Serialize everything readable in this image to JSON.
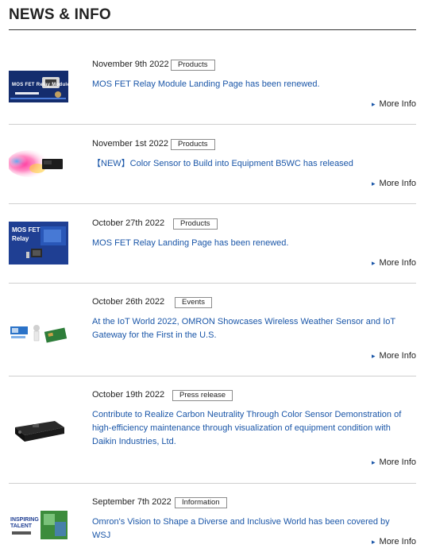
{
  "header": {
    "title": "NEWS & INFO"
  },
  "more_label": "More Info",
  "items": [
    {
      "date": "November 9th 2022",
      "category": "Products",
      "title": "MOS FET Relay Module Landing Page has been renewed.",
      "thumb_text": "MOS FET Relay Module"
    },
    {
      "date": "November 1st 2022",
      "category": "Products",
      "title": "【NEW】Color Sensor to Build into Equipment B5WC has released"
    },
    {
      "date": "October 27th 2022",
      "category": "Products",
      "title": "MOS FET Relay Landing Page has been renewed.",
      "thumb_line1": "MOS FET",
      "thumb_line2": "Relay"
    },
    {
      "date": "October 26th 2022",
      "category": "Events",
      "title": "At the IoT World 2022, OMRON Showcases Wireless Weather Sensor and IoT Gateway for the First in the U.S."
    },
    {
      "date": "October 19th 2022",
      "category": "Press release",
      "title": "Contribute to Realize Carbon Neutrality Through Color Sensor Demonstration of high-efficiency maintenance through visualization of equipment condition with Daikin Industries, Ltd."
    },
    {
      "date": "September 7th 2022",
      "category": "Information",
      "title": "Omron's Vision to Shape a Diverse and Inclusive World has been covered by WSJ",
      "thumb_text": "INSPIRING TALENT"
    }
  ]
}
